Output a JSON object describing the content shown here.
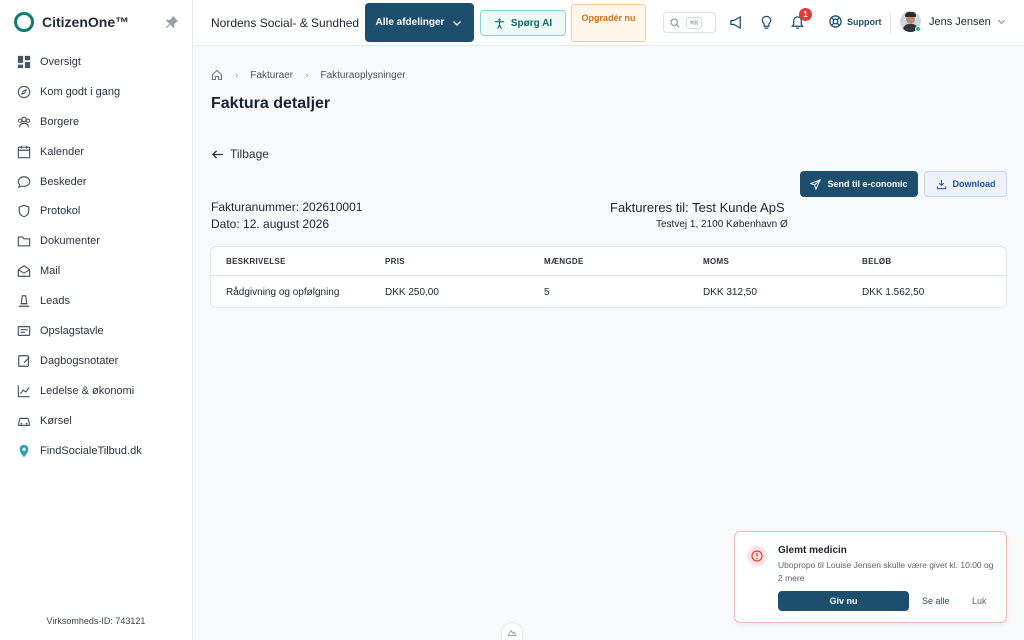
{
  "brand": {
    "name": "CitizenOne™",
    "color": "#0f7a73"
  },
  "sidebar": {
    "items": [
      {
        "label": "Oversigt",
        "icon": "dashboard-icon"
      },
      {
        "label": "Kom godt i gang",
        "icon": "compass-icon"
      },
      {
        "label": "Borgere",
        "icon": "users-icon"
      },
      {
        "label": "Kalender",
        "icon": "calendar-icon"
      },
      {
        "label": "Beskeder",
        "icon": "chat-icon"
      },
      {
        "label": "Protokol",
        "icon": "shield-icon"
      },
      {
        "label": "Dokumenter",
        "icon": "folder-icon"
      },
      {
        "label": "Mail",
        "icon": "mail-icon"
      },
      {
        "label": "Leads",
        "icon": "leads-icon"
      },
      {
        "label": "Opslagstavle",
        "icon": "board-icon"
      },
      {
        "label": "Dagbogsnotater",
        "icon": "note-icon"
      },
      {
        "label": "Ledelse & økonomi",
        "icon": "chart-icon"
      },
      {
        "label": "Kørsel",
        "icon": "car-icon"
      },
      {
        "label": "FindSocialeTilbud.dk",
        "icon": "map-pin-icon"
      }
    ],
    "company_id": "Virksomheds-ID: 743121"
  },
  "topbar": {
    "org_name": "Nordens Social- & Sundhed",
    "department_button": "Alle afdelinger",
    "ai_button": "Spørg AI",
    "upgrade_button": "Opgradér nu",
    "search_shortcut": "⌘K",
    "notification_count": "1",
    "support_label": "Support",
    "user_name": "Jens Jensen"
  },
  "breadcrumb": {
    "items": [
      "Fakturaer",
      "Fakturaoplysninger"
    ]
  },
  "page": {
    "title": "Faktura detaljer",
    "back_label": "Tilbage",
    "send_button": "Send til e-conomic",
    "download_button": "Download",
    "invoice_number": "Fakturanummer: 202610001",
    "invoice_date": "Dato: 12. august 2026",
    "bill_to": "Faktureres til: Test Kunde ApS",
    "bill_address": "Testvej 1, 2100 København Ø"
  },
  "table": {
    "headers": [
      "BESKRIVELSE",
      "PRIS",
      "MÆNGDE",
      "MOMS",
      "BELØB"
    ],
    "rows": [
      [
        "Rådgivning og opfølgning",
        "DKK 250,00",
        "5",
        "DKK 312,50",
        "DKK 1.562,50"
      ]
    ]
  },
  "toast": {
    "title": "Glemt medicin",
    "message": "Ubopropo til Louise Jensen skulle være givet kl. 10:00 og 2 mere",
    "primary_button": "Giv nu",
    "see_all": "Se alle",
    "close": "Luk"
  },
  "colors": {
    "primary": "#1e4e6e",
    "alert": "#e23b3b",
    "upgrade": "#c5731f"
  }
}
